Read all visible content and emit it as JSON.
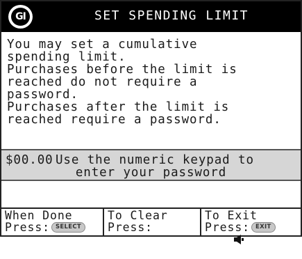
{
  "header": {
    "logo_text": "GI",
    "title": "SET SPENDING LIMIT"
  },
  "body": {
    "lines": [
      "You may set a cumulative",
      "spending limit.",
      "Purchases before the limit is",
      "reached do not require a",
      "password.",
      "Purchases after the limit is",
      "reached require a password."
    ]
  },
  "prompt": {
    "amount": "$00.00",
    "line1": "Use the numeric keypad to",
    "line2": "enter your password"
  },
  "footer": {
    "done": {
      "label": "When Done",
      "press": "Press:",
      "key": "SELECT"
    },
    "clear": {
      "label": "To Clear",
      "press": "Press:",
      "icon": "speaker-back-icon"
    },
    "exit": {
      "label": "To Exit",
      "press": "Press:",
      "key": "EXIT"
    }
  },
  "colors": {
    "title_bg": "#000000",
    "title_fg": "#ffffff",
    "prompt_bg": "#d6d6d6",
    "key_pill": "#c8c8c8"
  }
}
